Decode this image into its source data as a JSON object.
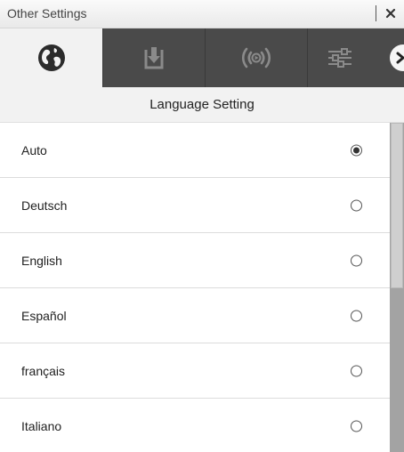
{
  "window": {
    "title": "Other Settings",
    "close_glyph": "×",
    "close_icon": "close-icon"
  },
  "tabs": [
    {
      "name": "globe-icon",
      "active": true
    },
    {
      "name": "download-icon",
      "active": false
    },
    {
      "name": "broadcast-icon",
      "active": false
    },
    {
      "name": "sliders-icon",
      "active": false
    }
  ],
  "scroll_tabs_icon": "chevron-right-icon",
  "section": {
    "title": "Language Setting"
  },
  "languages": [
    {
      "label": "Auto",
      "selected": true
    },
    {
      "label": "Deutsch",
      "selected": false
    },
    {
      "label": "English",
      "selected": false
    },
    {
      "label": "Español",
      "selected": false
    },
    {
      "label": "français",
      "selected": false
    },
    {
      "label": "Italiano",
      "selected": false
    }
  ],
  "colors": {
    "tabbar_bg": "#4a4a4a",
    "active_tab_bg": "#f2f2f2",
    "inactive_icon": "#8a8a8a",
    "active_icon": "#2b2b2b",
    "scrollbar_track": "#a3a3a3"
  }
}
